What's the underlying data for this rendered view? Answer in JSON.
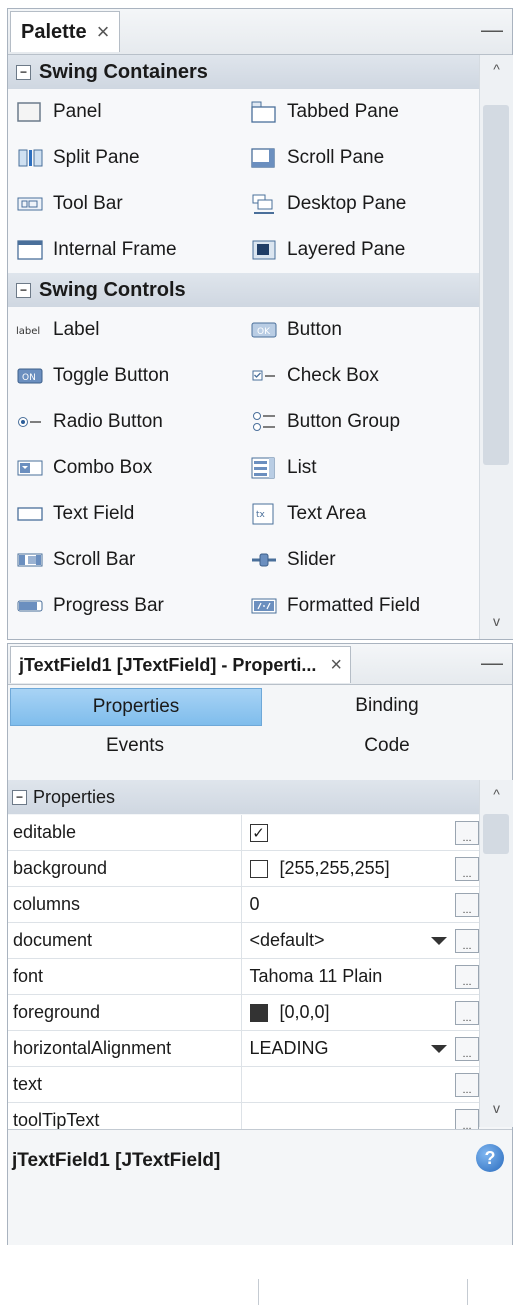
{
  "palette": {
    "tab_title": "Palette",
    "close": "×",
    "minimize": "—",
    "categories": [
      {
        "name": "Swing Containers",
        "toggle": "−",
        "items": [
          {
            "label": "Panel",
            "icon": "panel-icon"
          },
          {
            "label": "Tabbed Pane",
            "icon": "tabbed-pane-icon"
          },
          {
            "label": "Split Pane",
            "icon": "split-pane-icon"
          },
          {
            "label": "Scroll Pane",
            "icon": "scroll-pane-icon"
          },
          {
            "label": "Tool Bar",
            "icon": "tool-bar-icon"
          },
          {
            "label": "Desktop Pane",
            "icon": "desktop-pane-icon"
          },
          {
            "label": "Internal Frame",
            "icon": "internal-frame-icon"
          },
          {
            "label": "Layered Pane",
            "icon": "layered-pane-icon"
          }
        ]
      },
      {
        "name": "Swing Controls",
        "toggle": "−",
        "items": [
          {
            "label": "Label",
            "icon": "label-icon",
            "icon_text": "label"
          },
          {
            "label": "Button",
            "icon": "button-icon",
            "icon_text": "OK"
          },
          {
            "label": "Toggle Button",
            "icon": "toggle-button-icon",
            "icon_text": "ON"
          },
          {
            "label": "Check Box",
            "icon": "check-box-icon"
          },
          {
            "label": "Radio Button",
            "icon": "radio-button-icon"
          },
          {
            "label": "Button Group",
            "icon": "button-group-icon"
          },
          {
            "label": "Combo Box",
            "icon": "combo-box-icon"
          },
          {
            "label": "List",
            "icon": "list-icon"
          },
          {
            "label": "Text Field",
            "icon": "text-field-icon"
          },
          {
            "label": "Text Area",
            "icon": "text-area-icon",
            "icon_text": "tx"
          },
          {
            "label": "Scroll Bar",
            "icon": "scroll-bar-icon"
          },
          {
            "label": "Slider",
            "icon": "slider-icon"
          },
          {
            "label": "Progress Bar",
            "icon": "progress-bar-icon"
          },
          {
            "label": "Formatted Field",
            "icon": "formatted-field-icon"
          }
        ]
      }
    ]
  },
  "properties": {
    "tab_title": "jTextField1 [JTextField] - Properti...",
    "close": "×",
    "minimize": "—",
    "subtabs": [
      "Properties",
      "Binding",
      "Events",
      "Code"
    ],
    "active_subtab": "Properties",
    "section": "Properties",
    "section_toggle": "−",
    "more_button": "...",
    "rows": [
      {
        "name": "editable",
        "value": "",
        "kind": "checkbox",
        "checked": true
      },
      {
        "name": "background",
        "value": "[255,255,255]",
        "kind": "color",
        "color": "#ffffff"
      },
      {
        "name": "columns",
        "value": "0",
        "kind": "text"
      },
      {
        "name": "document",
        "value": "<default>",
        "kind": "dropdown"
      },
      {
        "name": "font",
        "value": "Tahoma 11 Plain",
        "kind": "text"
      },
      {
        "name": "foreground",
        "value": "[0,0,0]",
        "kind": "color",
        "color": "#333333"
      },
      {
        "name": "horizontalAlignment",
        "value": "LEADING",
        "kind": "dropdown"
      },
      {
        "name": "text",
        "value": "",
        "kind": "text"
      },
      {
        "name": "toolTipText",
        "value": "",
        "kind": "text"
      }
    ],
    "description_title": "jTextField1 [JTextField]",
    "help": "?"
  },
  "scroll": {
    "up": "^",
    "down": "v"
  },
  "colors": {
    "accent": "#7fbdec",
    "category_bg": "#d5dde6",
    "help": "#2a6bbd"
  }
}
